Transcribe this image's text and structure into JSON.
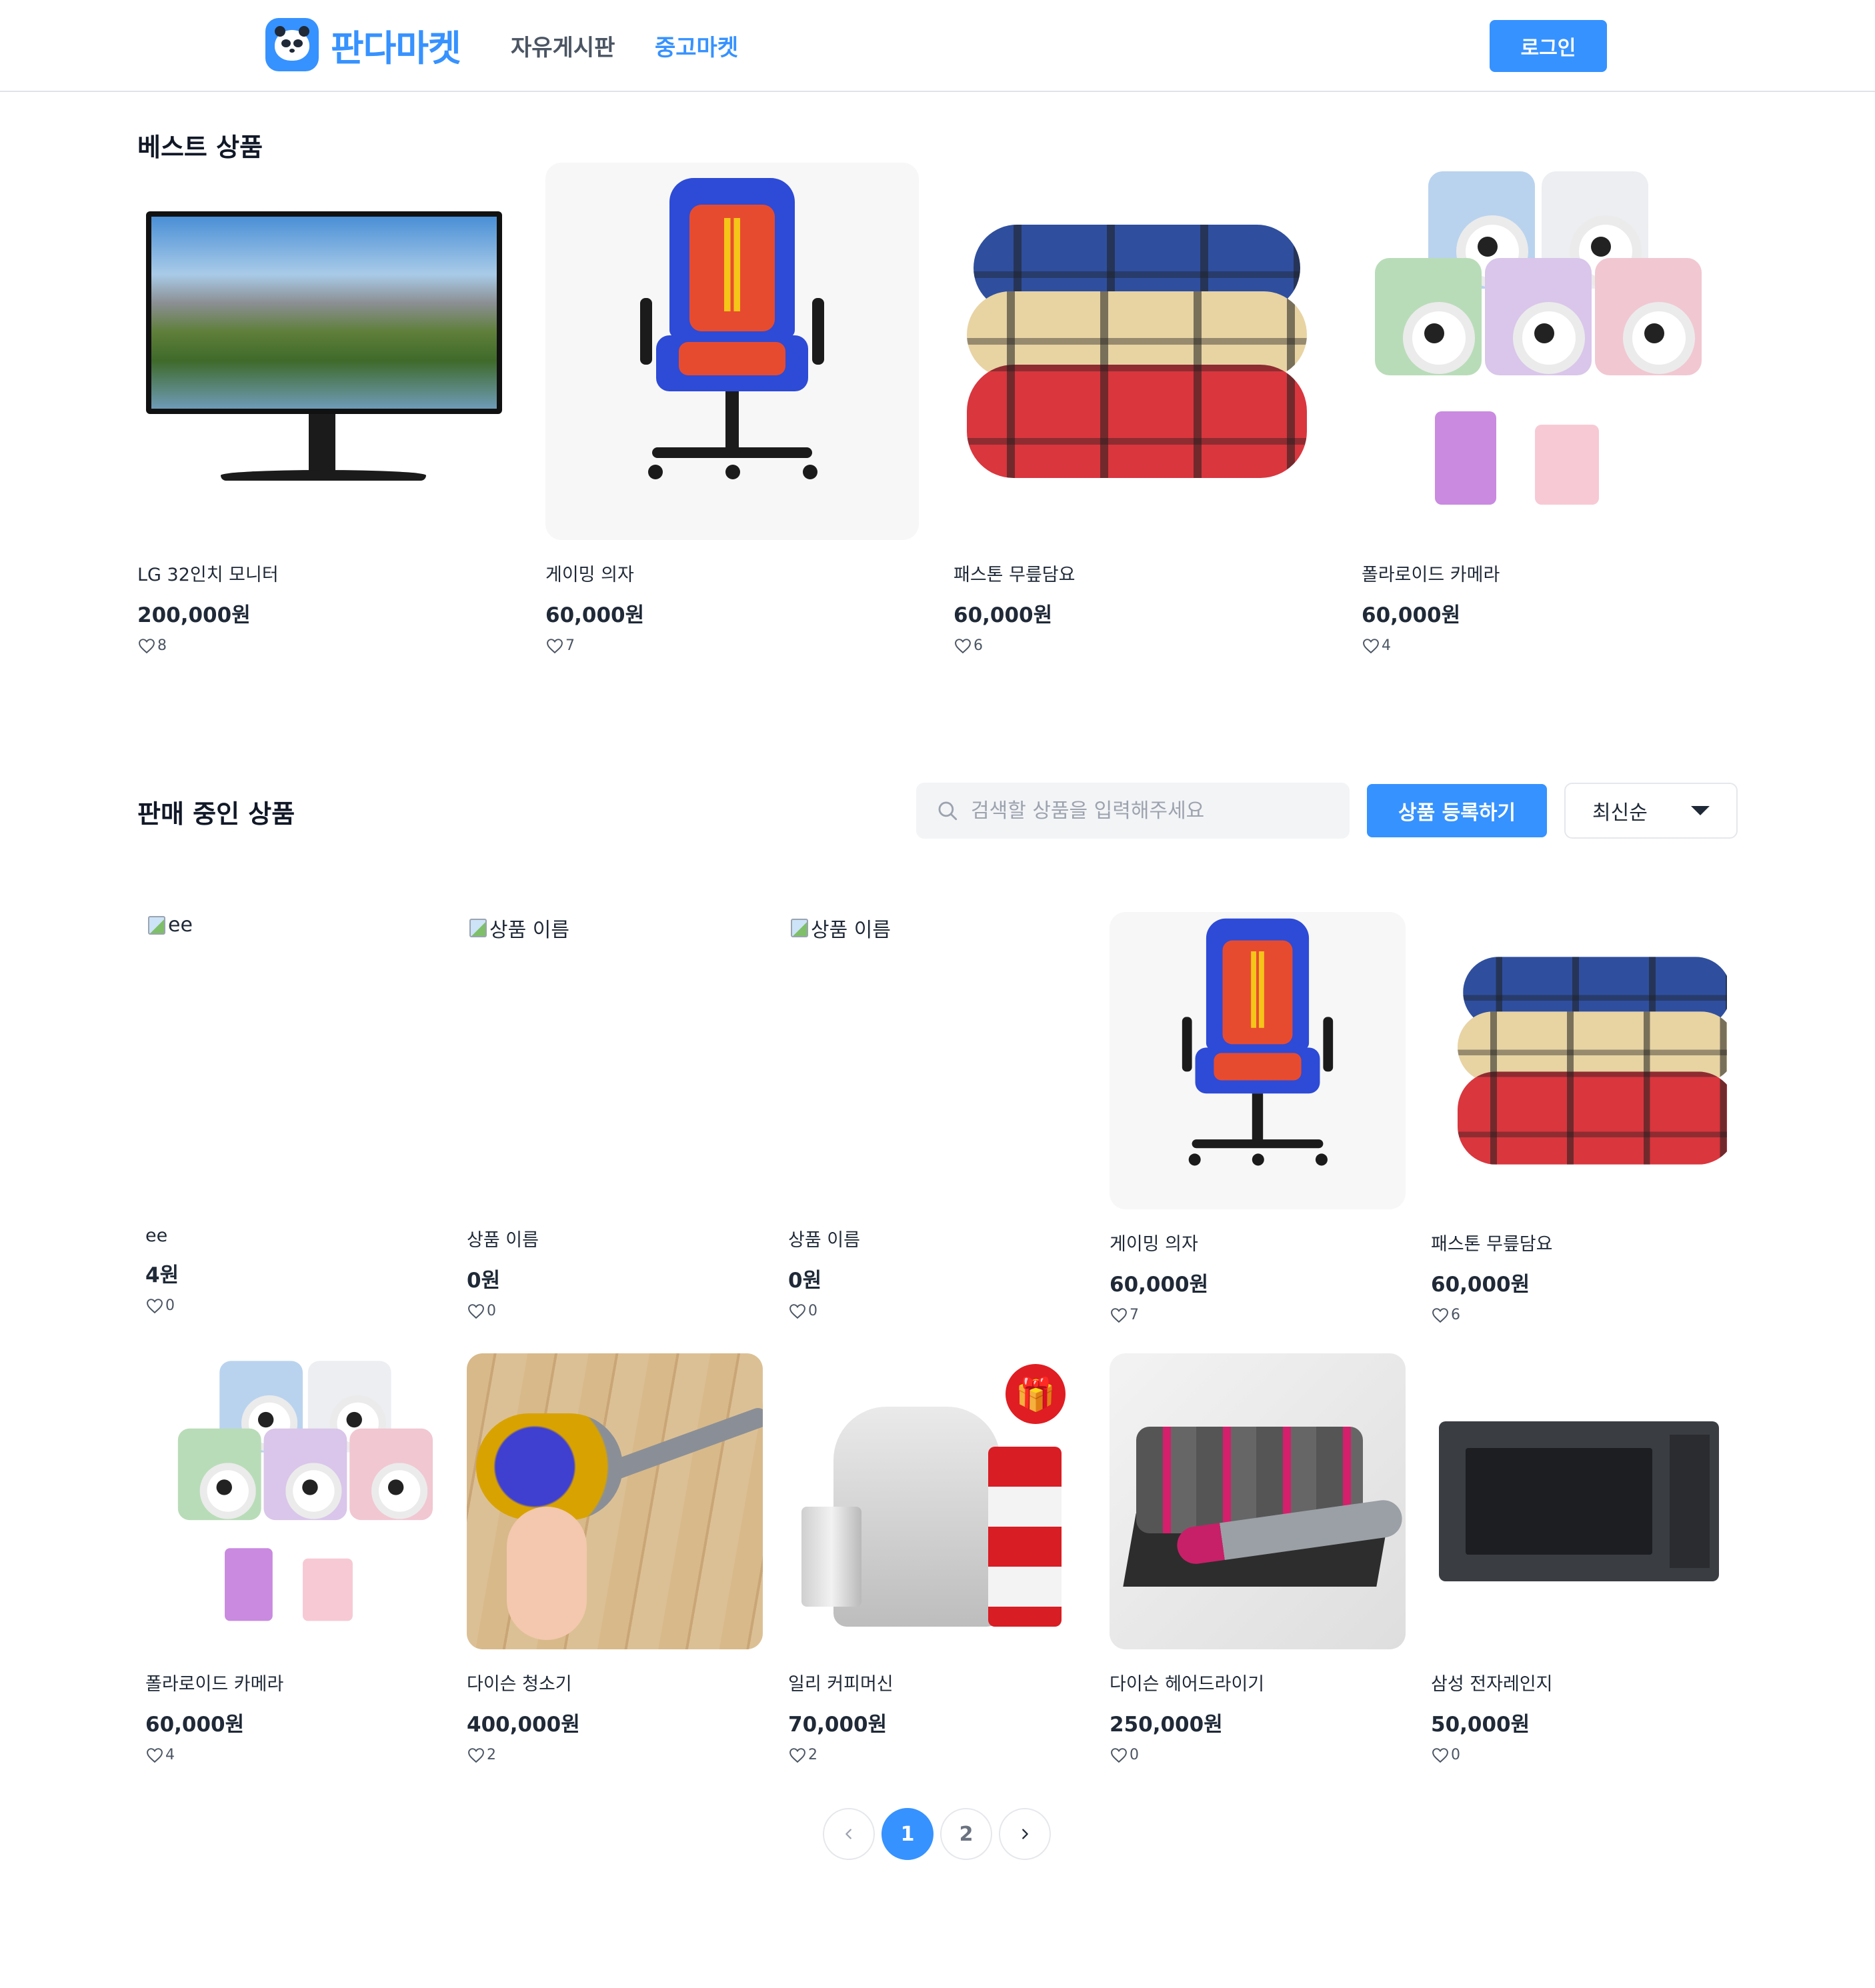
{
  "header": {
    "logo_text": "판다마켓",
    "nav": [
      {
        "label": "자유게시판",
        "active": false
      },
      {
        "label": "중고마켓",
        "active": true
      }
    ],
    "login_label": "로그인"
  },
  "best": {
    "title": "베스트 상품",
    "items": [
      {
        "name": "LG 32인치 모니터",
        "price": "200,000원",
        "likes": "8",
        "image": "monitor"
      },
      {
        "name": "게이밍 의자",
        "price": "60,000원",
        "likes": "7",
        "image": "gaming-chair"
      },
      {
        "name": "패스톤 무릎담요",
        "price": "60,000원",
        "likes": "6",
        "image": "blanket"
      },
      {
        "name": "폴라로이드 카메라",
        "price": "60,000원",
        "likes": "4",
        "image": "instax-cameras"
      }
    ]
  },
  "sale": {
    "title": "판매 중인 상품",
    "search_placeholder": "검색할 상품을 입력해주세요",
    "register_label": "상품 등록하기",
    "sort_label": "최신순",
    "items": [
      {
        "name": "ee",
        "price": "4원",
        "likes": "0",
        "image_alt": "ee",
        "image": "broken"
      },
      {
        "name": "상품 이름",
        "price": "0원",
        "likes": "0",
        "image_alt": "상품 이름",
        "image": "broken"
      },
      {
        "name": "상품 이름",
        "price": "0원",
        "likes": "0",
        "image_alt": "상품 이름",
        "image": "broken"
      },
      {
        "name": "게이밍 의자",
        "price": "60,000원",
        "likes": "7",
        "image": "gaming-chair"
      },
      {
        "name": "패스톤 무릎담요",
        "price": "60,000원",
        "likes": "6",
        "image": "blanket"
      },
      {
        "name": "폴라로이드 카메라",
        "price": "60,000원",
        "likes": "4",
        "image": "instax-cameras"
      },
      {
        "name": "다이슨 청소기",
        "price": "400,000원",
        "likes": "2",
        "image": "vacuum"
      },
      {
        "name": "일리 커피머신",
        "price": "70,000원",
        "likes": "2",
        "image": "coffee-machine"
      },
      {
        "name": "다이슨 헤어드라이기",
        "price": "250,000원",
        "likes": "0",
        "image": "hair-dryer"
      },
      {
        "name": "삼성 전자레인지",
        "price": "50,000원",
        "likes": "0",
        "image": "microwave"
      }
    ]
  },
  "pagination": {
    "pages": [
      "1",
      "2"
    ],
    "current": "1",
    "prev_icon": "chevron-left-icon",
    "next_icon": "chevron-right-icon"
  },
  "colors": {
    "accent": "#3692ff",
    "text": "#1f2937",
    "muted": "#4b5563"
  }
}
